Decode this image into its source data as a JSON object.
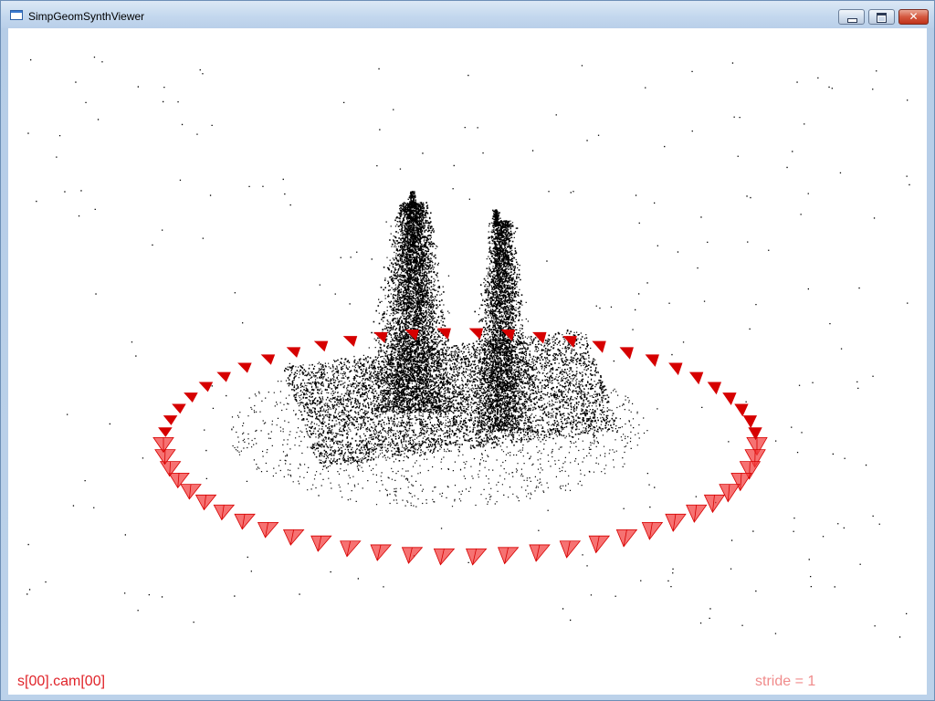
{
  "window": {
    "title": "SimpGeomSynthViewer",
    "icon": "window-app-icon",
    "controls": {
      "minimize": "minimize-icon",
      "maximize": "maximize-icon",
      "close_glyph": "✕"
    }
  },
  "viewer": {
    "camera_label": "s[00].cam[00]",
    "stride_label": "stride = 1",
    "colors": {
      "camera_label": "#e0242a",
      "stride_label": "#f08c8c",
      "camera_frustum": "#f23b3b",
      "camera_frustum_near": "#d60000",
      "point_cloud": "#000000",
      "background": "#ffffff"
    }
  }
}
